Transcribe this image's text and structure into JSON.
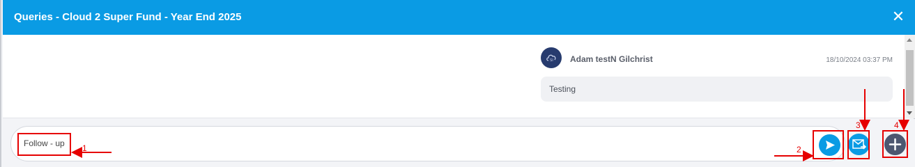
{
  "dialog": {
    "title": "Queries - Cloud 2 Super Fund - Year End 2025",
    "close_label": "✕"
  },
  "message": {
    "author": "Adam testN Gilchrist",
    "timestamp": "18/10/2024 03:37 PM",
    "text": "Testing"
  },
  "composer": {
    "value": "Follow - up"
  },
  "buttons": {
    "send_icon": "send-icon",
    "mail_icon": "email-send-icon",
    "add_icon": "plus-icon"
  },
  "annotations": {
    "labels": [
      "1",
      "2",
      "3",
      "4"
    ]
  },
  "colors": {
    "header": "#0a9be4",
    "accent": "#0a9be4",
    "add_button": "#4d5770",
    "annotation": "#e60000",
    "avatar": "#273b6e"
  }
}
